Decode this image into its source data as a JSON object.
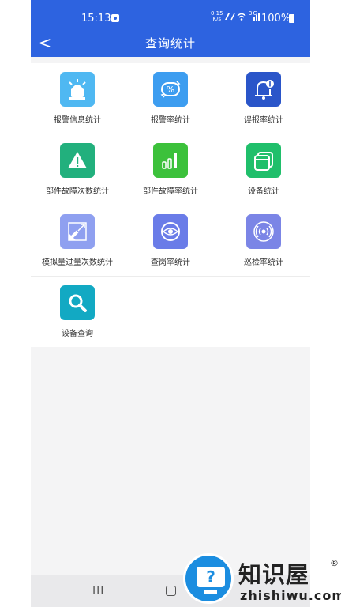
{
  "status_bar": {
    "time": "15:13",
    "net_speed_top": "0.15",
    "net_speed_bottom": "K/s",
    "signal_text": "3G",
    "battery": "100%"
  },
  "header": {
    "back_label": "<",
    "title": "查询统计"
  },
  "menu": [
    [
      {
        "label": "报警信息统计",
        "icon": "siren-icon",
        "color": "#4fb8f2"
      },
      {
        "label": "报警率统计",
        "icon": "percent-cycle-icon",
        "color": "#3d9df0"
      },
      {
        "label": "误报率统计",
        "icon": "bell-alert-icon",
        "color": "#2a55c9"
      }
    ],
    [
      {
        "label": "部件故障次数统计",
        "icon": "warning-triangle-icon",
        "color": "#22b07d"
      },
      {
        "label": "部件故障率统计",
        "icon": "bar-chart-icon",
        "color": "#3cc13b"
      },
      {
        "label": "设备统计",
        "icon": "stacked-cards-icon",
        "color": "#20bf6b"
      }
    ],
    [
      {
        "label": "模拟量过量次数统计",
        "icon": "expand-arrows-icon",
        "color": "#8fa0f0"
      },
      {
        "label": "查岗率统计",
        "icon": "eye-icon",
        "color": "#6a7ce8"
      },
      {
        "label": "巡检率统计",
        "icon": "signal-wave-icon",
        "color": "#7b85e6"
      }
    ],
    [
      {
        "label": "设备查询",
        "icon": "search-icon",
        "color": "#12a9c3"
      }
    ]
  ],
  "navigation": {
    "recent_label": "III"
  },
  "watermark": {
    "badge_glyph": "?",
    "brand_cn": "知识屋",
    "registered_mark": "®",
    "brand_en": "zhishiwu.com"
  }
}
